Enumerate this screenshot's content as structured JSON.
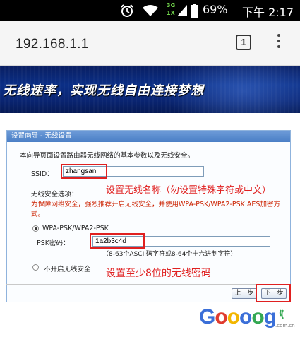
{
  "status_bar": {
    "battery": "69%",
    "time": "下午 2:17",
    "network_top": "3G",
    "network_bottom": "1X"
  },
  "browser": {
    "url": "192.168.1.1",
    "tab_count": "1"
  },
  "banner": {
    "text": "无线速率，实现无线自由连接梦想"
  },
  "wizard": {
    "title": "设置向导 - 无线设置",
    "description": "本向导页面设置路由器无线网络的基本参数以及无线安全。",
    "ssid_label": "SSID：",
    "ssid_value": "zhangsan",
    "security_label": "无线安全选项：",
    "warning": "为保障网络安全，强烈推荐开启无线安全，并使用WPA-PSK/WPA2-PSK AES加密方式。",
    "option_wpa": "WPA-PSK/WPA2-PSK",
    "psk_label": "PSK密码：",
    "psk_value": "1a2b3c4d",
    "psk_hint": "（8-63个ASCII码字符或8-64个十六进制字符）",
    "option_none": "不开启无线安全",
    "btn_prev": "上一步",
    "btn_next": "下一步"
  },
  "annotations": {
    "ssid_note": "设置无线名称（勿设置特殊字符或中文）",
    "psk_note": "设置至少8位的无线密码"
  },
  "watermark": {
    "brand": "Goooog",
    "suffix": ".com.cn"
  },
  "colors": {
    "annotation_red": "#e02020",
    "panel_title_blue": "#4a7fc6",
    "banner_blue": "#0b2f86"
  }
}
